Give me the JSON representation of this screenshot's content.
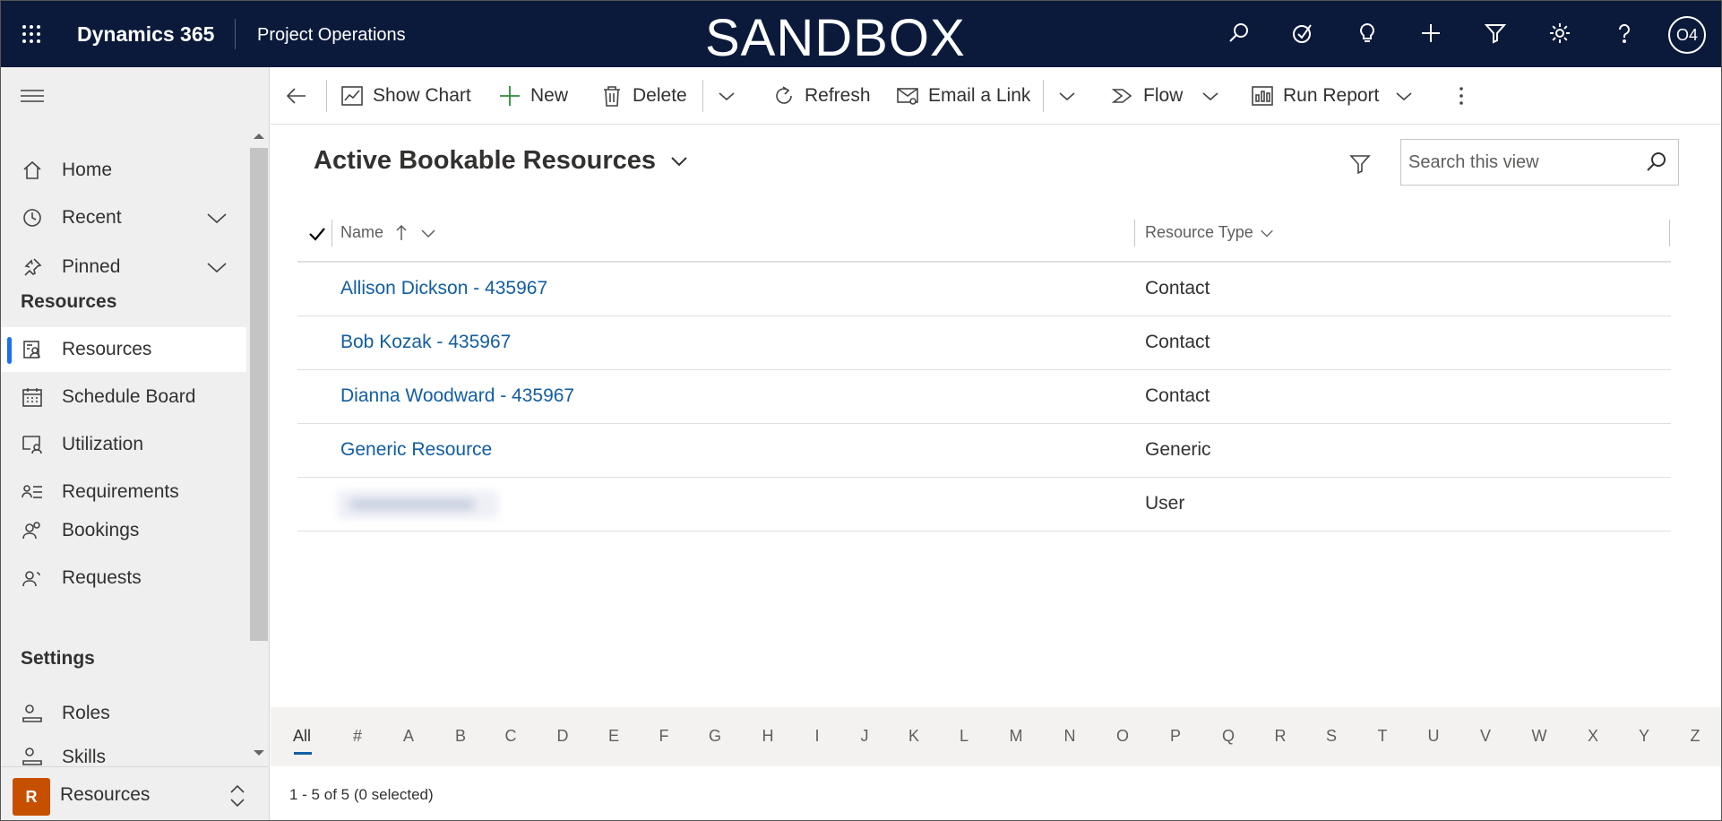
{
  "topbar": {
    "brand": "Dynamics 365",
    "app": "Project Operations",
    "environment_banner": "SANDBOX",
    "user_initials": "O4",
    "icons": [
      "search-icon",
      "task-check-icon",
      "lightbulb-icon",
      "plus-icon",
      "filter-icon",
      "gear-icon",
      "help-icon"
    ],
    "background_color": "#0b1a3b"
  },
  "sidebar": {
    "items": [
      {
        "label": "Home",
        "icon": "home-icon"
      },
      {
        "label": "Recent",
        "icon": "clock-icon",
        "expandable": true
      },
      {
        "label": "Pinned",
        "icon": "pin-icon",
        "expandable": true
      }
    ],
    "section_resources": "Resources",
    "resource_items": [
      {
        "label": "Resources",
        "icon": "resource-icon",
        "active": true
      },
      {
        "label": "Schedule Board",
        "icon": "calendar-icon"
      },
      {
        "label": "Utilization",
        "icon": "utilization-icon"
      },
      {
        "label": "Requirements",
        "icon": "requirements-icon"
      },
      {
        "label": "Bookings",
        "icon": "bookings-icon"
      },
      {
        "label": "Requests",
        "icon": "requests-icon"
      }
    ],
    "section_settings": "Settings",
    "settings_items": [
      {
        "label": "Roles",
        "icon": "roles-icon"
      },
      {
        "label": "Skills",
        "icon": "skills-icon"
      }
    ],
    "area_switcher": {
      "badge": "R",
      "label": "Resources",
      "badge_color": "#c75000"
    },
    "active_indicator_color": "#1a73e8"
  },
  "commandbar": {
    "show_chart": "Show Chart",
    "new": "New",
    "delete": "Delete",
    "refresh": "Refresh",
    "email_link": "Email a Link",
    "flow": "Flow",
    "run_report": "Run Report"
  },
  "view": {
    "title": "Active Bookable Resources",
    "search_placeholder": "Search this view",
    "columns": {
      "name": "Name",
      "resource_type": "Resource Type"
    },
    "rows": [
      {
        "name": "Allison Dickson - 435967",
        "type": "Contact"
      },
      {
        "name": "Bob Kozak - 435967",
        "type": "Contact"
      },
      {
        "name": "Dianna Woodward - 435967",
        "type": "Contact"
      },
      {
        "name": "Generic Resource",
        "type": "Generic"
      },
      {
        "name": "",
        "type": "User",
        "redacted": true
      }
    ],
    "link_color": "#115ea3"
  },
  "jumpbar": [
    "All",
    "#",
    "A",
    "B",
    "C",
    "D",
    "E",
    "F",
    "G",
    "H",
    "I",
    "J",
    "K",
    "L",
    "M",
    "N",
    "O",
    "P",
    "Q",
    "R",
    "S",
    "T",
    "U",
    "V",
    "W",
    "X",
    "Y",
    "Z"
  ],
  "footer": {
    "record_count": "1 - 5 of 5 (0 selected)"
  }
}
